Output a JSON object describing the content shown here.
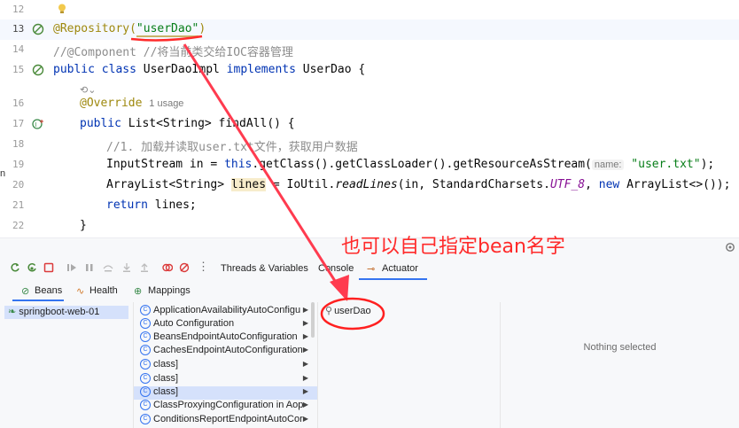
{
  "editor": {
    "lines": [
      {
        "num": "12"
      },
      {
        "num": "13",
        "ann": "@Repository(",
        "str": "\"userDao\"",
        "close": ")"
      },
      {
        "num": "14",
        "comment": "//@Component //将当前类交给IOC容器管理"
      },
      {
        "num": "15",
        "kw1": "public class ",
        "name": "UserDaoImpl ",
        "kw2": "implements ",
        "rest": "UserDao {"
      },
      {
        "num": "16",
        "ann": "@Override",
        "usage": "1 usage"
      },
      {
        "num": "17",
        "kw": "public ",
        "rest": "List<String> findAll() {"
      },
      {
        "num": "18",
        "comment": "//1. 加载并读取user.txt文件，获取用户数据"
      },
      {
        "num": "19",
        "a": "InputStream in = ",
        "kw": "this",
        "b": ".getClass().getClassLoader().getResourceAsStream(",
        "hint": "name:",
        "str": "\"user.txt\"",
        "c": ");"
      },
      {
        "num": "20",
        "a": "ArrayList<String> ",
        "var": "lines",
        "b": " = IoUtil.",
        "it": "readLines",
        "c": "(in, StandardCharsets.",
        "const": "UTF_8",
        "d": ", ",
        "kw": "new ",
        "e": "ArrayList<>());"
      },
      {
        "num": "21",
        "kw": "return ",
        "rest": "lines;"
      },
      {
        "num": "22",
        "rest": "}"
      }
    ],
    "left_fragment": "n"
  },
  "toolbar": {
    "tabs": [
      "Threads & Variables",
      "Console",
      "Actuator"
    ]
  },
  "subtabs": [
    "Beans",
    "Health",
    "Mappings"
  ],
  "beans": {
    "app": "springboot-web-01",
    "classes": [
      "ApplicationAvailabilityAutoConfigu",
      "Auto Configuration",
      "BeansEndpointAutoConfiguration",
      "CachesEndpointAutoConfiguration",
      "class]",
      "class]",
      "class]",
      "ClassProxyingConfiguration in Aop",
      "ConditionsReportEndpointAutoCor"
    ],
    "bean": "userDao",
    "detail": "Nothing selected"
  },
  "annotation": {
    "text": "也可以自己指定bean名字",
    "color": "#ff2a2a"
  }
}
